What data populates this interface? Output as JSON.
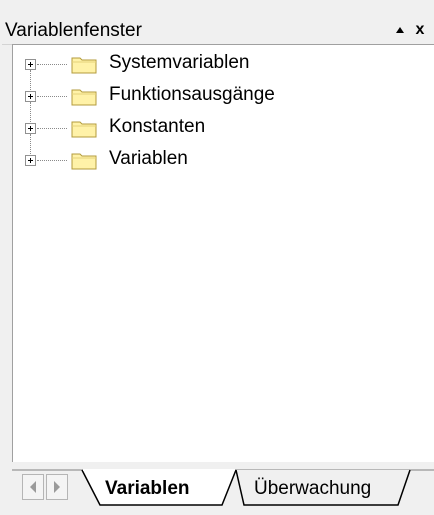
{
  "panel": {
    "title": "Variablenfenster",
    "pin_glyph": "▲",
    "close_glyph": "x"
  },
  "tree": {
    "items": [
      {
        "label": "Systemvariablen",
        "icon": "folder-icon",
        "expanded": false
      },
      {
        "label": "Funktionsausgänge",
        "icon": "folder-icon",
        "expanded": false
      },
      {
        "label": "Konstanten",
        "icon": "folder-icon",
        "expanded": false
      },
      {
        "label": "Variablen",
        "icon": "folder-icon",
        "expanded": false
      }
    ]
  },
  "tabs": [
    {
      "label": "Variablen",
      "active": true
    },
    {
      "label": "Überwachung",
      "active": false
    }
  ],
  "colors": {
    "folder_fill": "#fff2a8",
    "folder_stroke": "#b39b3c",
    "tree_bg": "#ffffff",
    "panel_bg": "#f0f0f0"
  }
}
